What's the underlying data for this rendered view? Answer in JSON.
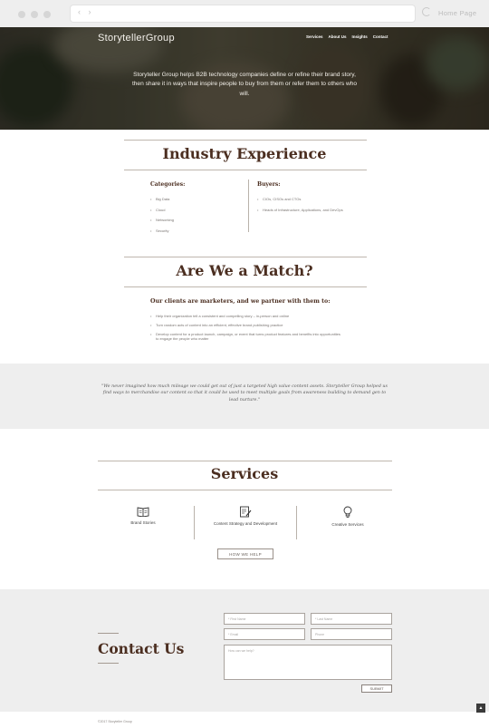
{
  "browser": {
    "nav_arrows": "‹ ›",
    "home_label": "Home Page"
  },
  "header": {
    "brand": "StorytellerGroup",
    "nav": [
      "Services",
      "About Us",
      "Insights",
      "Contact"
    ],
    "tagline": "Storyteller Group helps B2B technology companies define or refine their brand story, then share it in ways that inspire people to buy from them or refer them to others who will."
  },
  "industry": {
    "title": "Industry Experience",
    "categories_title": "Categories:",
    "categories": [
      "Big Data",
      "Cloud",
      "Networking",
      "Security"
    ],
    "buyers_title": "Buyers:",
    "buyers": [
      "CIOs, CISOs and CTOs",
      "Heads of Infrastructure, Applications, and DevOps"
    ]
  },
  "match": {
    "title": "Are We a Match?",
    "subtitle": "Our clients are marketers, and we partner with them to:",
    "items": [
      "Help their organization tell a consistent and compelling story – in-person and online",
      "Turn random acts of content into an efficient, effective brand publishing practice",
      "Develop content for a product launch, campaign, or event that turns product features and benefits into opportunities to engage the people who matter"
    ]
  },
  "testimonial": {
    "quote": "\"We never imagined how much mileage we could get out of just a targeted high value content assets. Storyteller Group helped us find ways to merchandise our content so that it could be used to meet multiple goals from awareness building to demand gen to lead nurture.\""
  },
  "services": {
    "title": "Services",
    "items": [
      {
        "label": "Brand Stories",
        "icon": "book-icon"
      },
      {
        "label": "Content Strategy and Development",
        "icon": "document-pen-icon"
      },
      {
        "label": "Creative Services",
        "icon": "lightbulb-icon"
      }
    ],
    "button": "HOW WE HELP"
  },
  "contact": {
    "title": "Contact Us",
    "first_name": "* First Name",
    "last_name": "* Last Name",
    "email": "* Email",
    "phone": "Phone",
    "message": "How can we help?",
    "submit": "SUBMIT"
  },
  "footer": {
    "copyright": "©2017 Storyteller Group",
    "to_top": "▲"
  },
  "colors": {
    "accent_brown": "#4b2e20",
    "band_gray": "#eeeeee"
  }
}
